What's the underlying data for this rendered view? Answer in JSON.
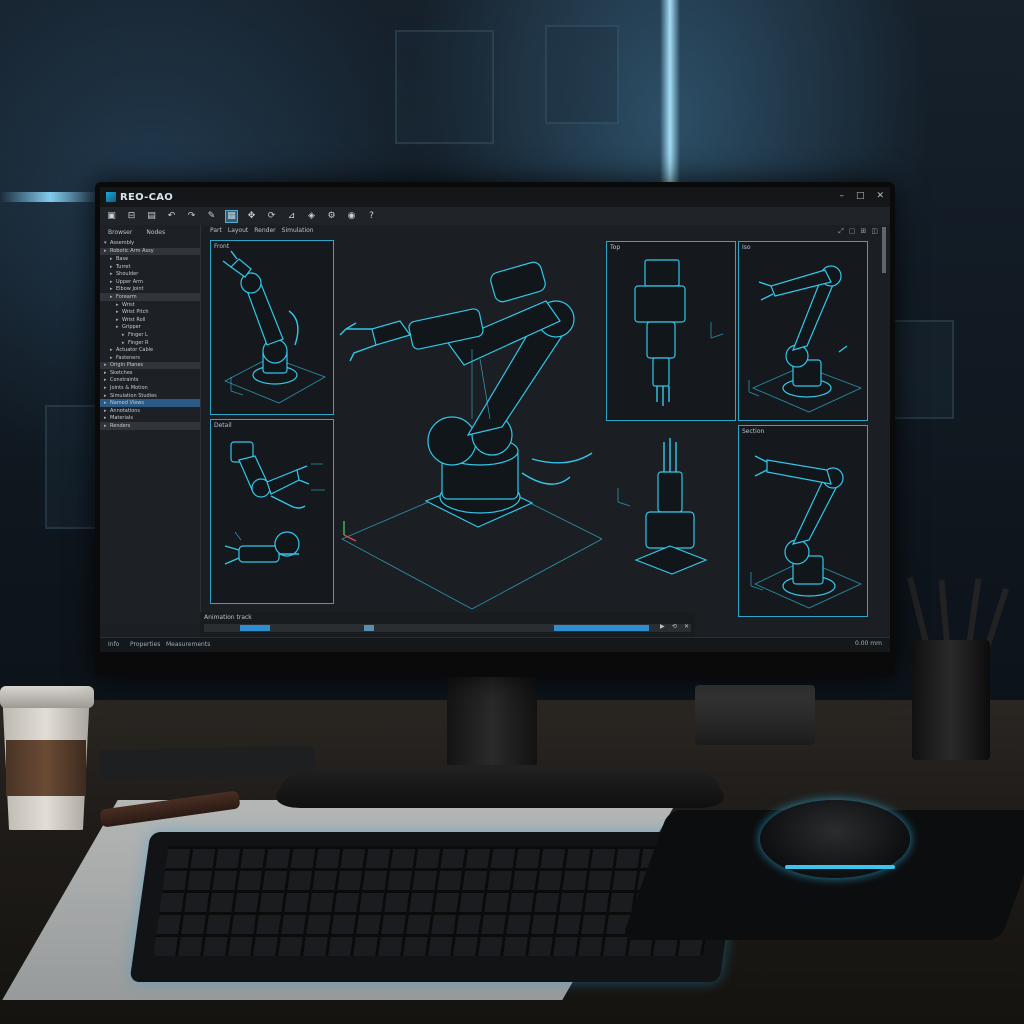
{
  "app": {
    "title": "REO-CAO",
    "window_controls": [
      "–",
      "□",
      "✕"
    ]
  },
  "toolbar": {
    "icons": [
      "new-file-icon",
      "open-icon",
      "save-icon",
      "undo-icon",
      "redo-icon",
      "sketch-icon",
      "select-icon",
      "move-icon",
      "rotate-icon",
      "measure-icon",
      "render-icon",
      "settings-icon",
      "view-icon",
      "help-icon"
    ]
  },
  "sidebar": {
    "tabs": [
      "Browser",
      "Nodes"
    ],
    "header": "Assembly",
    "items": [
      {
        "label": "Robotic Arm Assy",
        "level": 0,
        "state": "grey"
      },
      {
        "label": "Base",
        "level": 1,
        "state": ""
      },
      {
        "label": "Turret",
        "level": 1,
        "state": ""
      },
      {
        "label": "Shoulder",
        "level": 1,
        "state": ""
      },
      {
        "label": "Upper Arm",
        "level": 1,
        "state": ""
      },
      {
        "label": "Elbow Joint",
        "level": 1,
        "state": ""
      },
      {
        "label": "Forearm",
        "level": 1,
        "state": "grey"
      },
      {
        "label": "Wrist",
        "level": 2,
        "state": ""
      },
      {
        "label": "Wrist Pitch",
        "level": 2,
        "state": ""
      },
      {
        "label": "Wrist Roll",
        "level": 2,
        "state": ""
      },
      {
        "label": "Gripper",
        "level": 2,
        "state": ""
      },
      {
        "label": "Finger L",
        "level": 3,
        "state": ""
      },
      {
        "label": "Finger R",
        "level": 3,
        "state": ""
      },
      {
        "label": "Actuator Cable",
        "level": 1,
        "state": ""
      },
      {
        "label": "Fasteners",
        "level": 1,
        "state": ""
      },
      {
        "label": "Origin Planes",
        "level": 0,
        "state": "grey"
      },
      {
        "label": "Sketches",
        "level": 0,
        "state": ""
      },
      {
        "label": "Constraints",
        "level": 0,
        "state": ""
      },
      {
        "label": "Joints & Motion",
        "level": 0,
        "state": ""
      },
      {
        "label": "Simulation Studies",
        "level": 0,
        "state": ""
      },
      {
        "label": "Named Views",
        "level": 0,
        "state": "sel"
      },
      {
        "label": "Annotations",
        "level": 0,
        "state": ""
      },
      {
        "label": "Materials",
        "level": 0,
        "state": ""
      },
      {
        "label": "Renders",
        "level": 0,
        "state": "grey"
      }
    ]
  },
  "view_tabs": [
    "Part",
    "Layout",
    "Render",
    "Simulation"
  ],
  "viewports": [
    {
      "label": "Front"
    },
    {
      "label": "Detail"
    },
    {
      "label": "Top"
    },
    {
      "label": "Iso"
    },
    {
      "label": "Section"
    }
  ],
  "timeline": {
    "label": "Animation track"
  },
  "statusbar": {
    "tabs": [
      "Info",
      "Properties",
      "Measurements"
    ],
    "right": "0.00 mm"
  },
  "colors": {
    "accent": "#33c6e8",
    "selection": "#2c5a86",
    "panel": "#1b1e22"
  }
}
